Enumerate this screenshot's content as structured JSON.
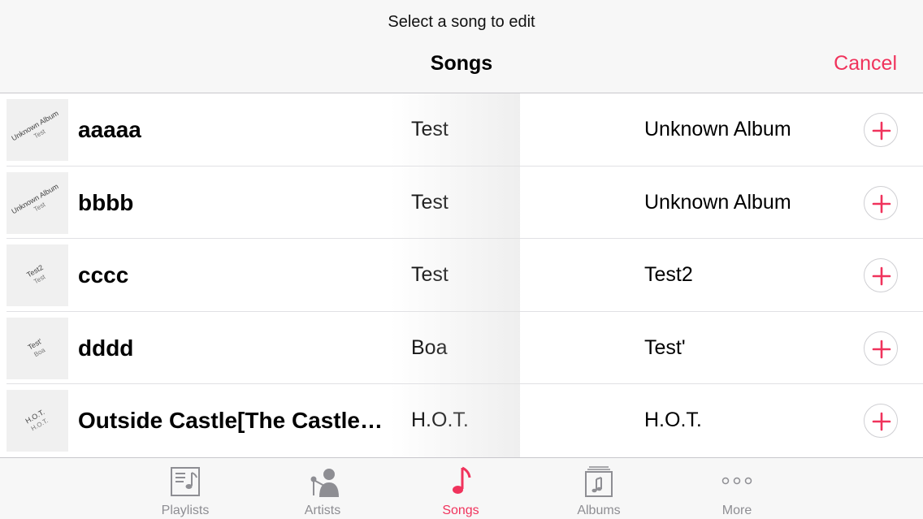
{
  "header": {
    "prompt": "Select a song to edit",
    "title": "Songs",
    "cancel_label": "Cancel"
  },
  "songs": [
    {
      "title": "aaaaa",
      "artist": "Test",
      "album": "Unknown Album",
      "art_line1": "Unknown Album",
      "art_line2": "Test"
    },
    {
      "title": "bbbb",
      "artist": "Test",
      "album": "Unknown Album",
      "art_line1": "Unknown Album",
      "art_line2": "Test"
    },
    {
      "title": "cccc",
      "artist": "Test",
      "album": "Test2",
      "art_line1": "Test2",
      "art_line2": "Test"
    },
    {
      "title": "dddd",
      "artist": "Boa",
      "album": "Test'",
      "art_line1": "Test'",
      "art_line2": "Boa"
    },
    {
      "title": "Outside Castle[The Castle…",
      "artist": "H.O.T.",
      "album": "H.O.T.",
      "art_line1": "H.O.T.",
      "art_line2": "H.O.T."
    }
  ],
  "add_icon": "plus-circle-icon",
  "tabs": [
    {
      "label": "Playlists",
      "icon": "playlists-icon",
      "active": false
    },
    {
      "label": "Artists",
      "icon": "artists-icon",
      "active": false
    },
    {
      "label": "Songs",
      "icon": "music-note-icon",
      "active": true
    },
    {
      "label": "Albums",
      "icon": "albums-icon",
      "active": false
    },
    {
      "label": "More",
      "icon": "more-icon",
      "active": false
    }
  ],
  "colors": {
    "accent": "#f0335c",
    "inactive": "#8e8e93",
    "bar_background": "#f7f7f7",
    "separator": "#c8c7cc"
  }
}
